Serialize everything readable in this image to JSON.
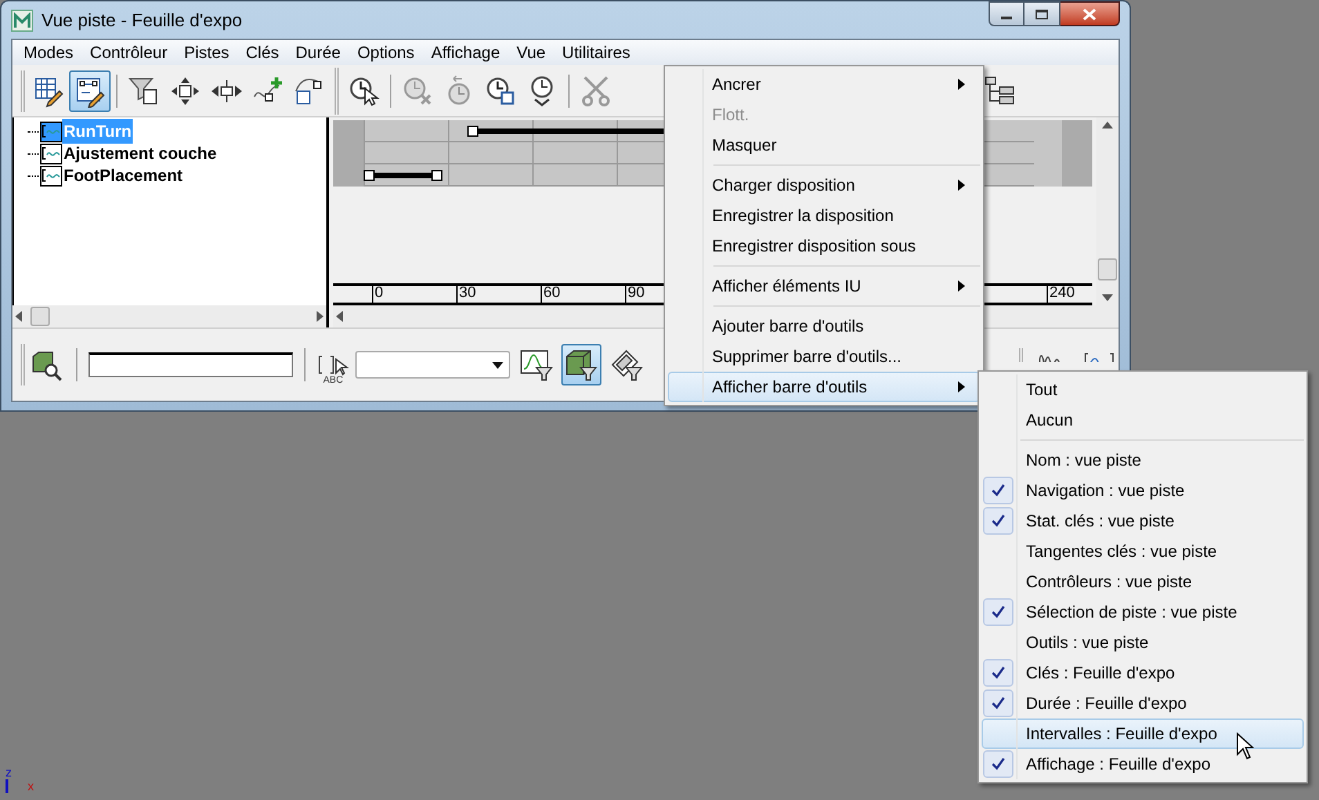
{
  "window": {
    "title": "Vue piste - Feuille d'expo"
  },
  "menu_bar": [
    "Modes",
    "Contrôleur",
    "Pistes",
    "Clés",
    "Durée",
    "Options",
    "Affichage",
    "Vue",
    "Utilitaires"
  ],
  "toolbar": {
    "groups": [
      [
        {
          "kind": "grid-pencil",
          "selected": false
        },
        {
          "kind": "curve-pencil",
          "selected": true
        }
      ],
      [
        {
          "kind": "filter",
          "selected": false
        },
        {
          "kind": "move",
          "selected": false
        },
        {
          "kind": "slide",
          "selected": false
        },
        {
          "kind": "add-key",
          "selected": false
        },
        {
          "kind": "scale",
          "selected": false
        }
      ],
      [
        {
          "kind": "clock-cursor",
          "selected": false
        }
      ],
      [
        {
          "kind": "clock-x",
          "selected": false
        },
        {
          "kind": "clock-back",
          "selected": false
        },
        {
          "kind": "clock-box",
          "selected": false
        },
        {
          "kind": "clock-down",
          "selected": false
        }
      ],
      [
        {
          "kind": "scissors",
          "selected": false
        }
      ]
    ],
    "end": [
      {
        "kind": "hierarchy",
        "selected": false
      }
    ]
  },
  "tree": {
    "items": [
      {
        "label": "RunTurn",
        "selected": true
      },
      {
        "label": "Ajustement couche",
        "selected": false
      },
      {
        "label": "FootPlacement",
        "selected": false
      }
    ]
  },
  "ruler": {
    "labels": [
      "0",
      "30",
      "60",
      "90"
    ],
    "end_label": "240"
  },
  "bottom_toolbar": {
    "abc_label": "ABC",
    "buttons": [
      {
        "kind": "curve-filter",
        "selected": false
      },
      {
        "kind": "cube-filter",
        "selected": true
      },
      {
        "kind": "film-filter",
        "selected": false
      }
    ],
    "end": [
      {
        "kind": "wave",
        "selected": false
      },
      {
        "kind": "bracket-wave",
        "selected": false
      }
    ]
  },
  "context_menu": {
    "groups": [
      [
        {
          "label": "Ancrer",
          "disabled": false,
          "submenu": true,
          "selected": false
        },
        {
          "label": "Flott.",
          "disabled": true,
          "submenu": false,
          "selected": false
        },
        {
          "label": "Masquer",
          "disabled": false,
          "submenu": false,
          "selected": false
        }
      ],
      [
        {
          "label": "Charger disposition",
          "disabled": false,
          "submenu": true,
          "selected": false
        },
        {
          "label": "Enregistrer la disposition",
          "disabled": false,
          "submenu": false,
          "selected": false
        },
        {
          "label": "Enregistrer disposition sous",
          "disabled": false,
          "submenu": false,
          "selected": false
        }
      ],
      [
        {
          "label": "Afficher éléments IU",
          "disabled": false,
          "submenu": true,
          "selected": false
        }
      ],
      [
        {
          "label": "Ajouter barre d'outils",
          "disabled": false,
          "submenu": false,
          "selected": false
        },
        {
          "label": "Supprimer barre d'outils...",
          "disabled": false,
          "submenu": false,
          "selected": false
        },
        {
          "label": "Afficher barre d'outils",
          "disabled": false,
          "submenu": true,
          "selected": true
        }
      ]
    ]
  },
  "submenu": {
    "groups": [
      [
        {
          "label": "Tout",
          "checked": false,
          "selected": false
        },
        {
          "label": "Aucun",
          "checked": false,
          "selected": false
        }
      ],
      [
        {
          "label": "Nom : vue piste",
          "checked": false,
          "selected": false
        },
        {
          "label": "Navigation : vue piste",
          "checked": true,
          "selected": false
        },
        {
          "label": "Stat. clés : vue piste",
          "checked": true,
          "selected": false
        },
        {
          "label": "Tangentes clés : vue piste",
          "checked": false,
          "selected": false
        },
        {
          "label": "Contrôleurs : vue piste",
          "checked": false,
          "selected": false
        },
        {
          "label": "Sélection de piste : vue piste",
          "checked": true,
          "selected": false
        },
        {
          "label": "Outils : vue piste",
          "checked": false,
          "selected": false
        },
        {
          "label": "Clés : Feuille d'expo",
          "checked": true,
          "selected": false
        },
        {
          "label": "Durée : Feuille d'expo",
          "checked": true,
          "selected": false
        },
        {
          "label": "Intervalles : Feuille d'expo",
          "checked": false,
          "selected": true
        },
        {
          "label": "Affichage : Feuille d'expo",
          "checked": true,
          "selected": false
        }
      ]
    ]
  },
  "axis": {
    "labels": [
      "z",
      "x"
    ]
  }
}
